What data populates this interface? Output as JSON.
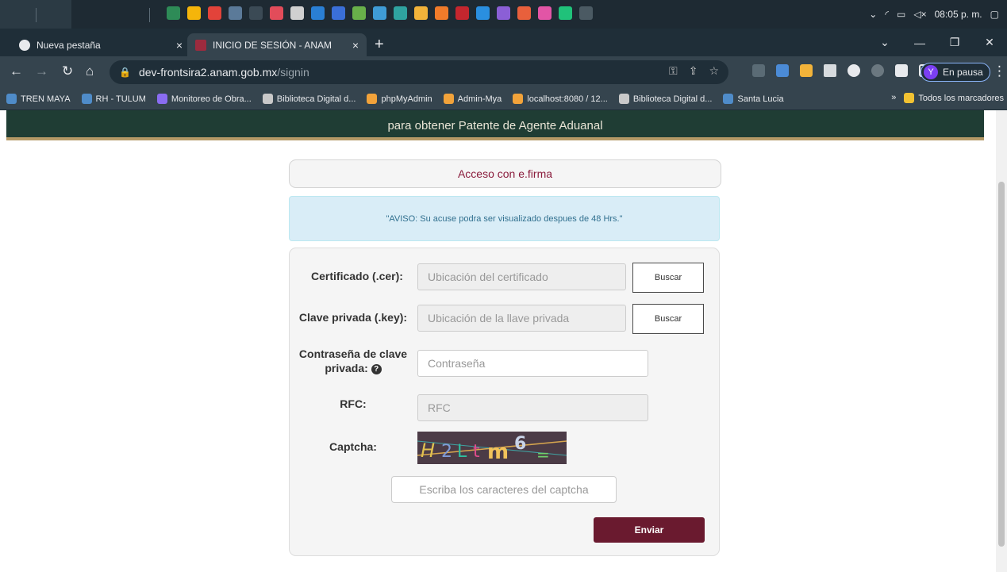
{
  "taskbar": {
    "clock": "08:05 p. m."
  },
  "tabs": [
    {
      "label": "Nueva pestaña"
    },
    {
      "label": "INICIO DE SESIÓN - ANAM"
    }
  ],
  "address": {
    "host": "dev-frontsira2.anam.gob.mx",
    "path": "/signin"
  },
  "profile": {
    "initial": "Y",
    "label": "En pausa"
  },
  "bookmarks": [
    {
      "label": "TREN MAYA",
      "color": "#4f8cc9"
    },
    {
      "label": "RH - TULUM",
      "color": "#4f8cc9"
    },
    {
      "label": "Monitoreo de Obra...",
      "color": "#8a6cf2"
    },
    {
      "label": "Biblioteca Digital d...",
      "color": "#c9c9c9"
    },
    {
      "label": "phpMyAdmin",
      "color": "#f2a33a"
    },
    {
      "label": "Admin-Mya",
      "color": "#f2a33a"
    },
    {
      "label": "localhost:8080 / 12...",
      "color": "#f2a33a"
    },
    {
      "label": "Biblioteca Digital d...",
      "color": "#c9c9c9"
    },
    {
      "label": "Santa Lucia",
      "color": "#4f8cc9"
    }
  ],
  "bookmarks_more": "»",
  "bookmarks_all": "Todos los marcadores",
  "banner": {
    "text": "para obtener Patente de Agente Aduanal"
  },
  "access_title": "Acceso con e.firma",
  "notice": "\"AVISO: Su acuse podra ser visualizado despues de 48 Hrs.\"",
  "form": {
    "cert_label": "Certificado (.cer):",
    "cert_placeholder": "Ubicación del certificado",
    "key_label": "Clave privada (.key):",
    "key_placeholder": "Ubicación de la llave privada",
    "browse": "Buscar",
    "password_label_1": "Contraseña de clave",
    "password_label_2": "privada:",
    "password_placeholder": "Contraseña",
    "rfc_label": "RFC:",
    "rfc_placeholder": "RFC",
    "captcha_label": "Captcha:",
    "captcha_text": "H2Ltm6=",
    "captcha_placeholder": "Escriba los caracteres del captcha",
    "submit": "Enviar"
  },
  "colors": {
    "accent": "#6a1a2f",
    "banner": "#1f3d34",
    "gold": "#b59a67"
  }
}
